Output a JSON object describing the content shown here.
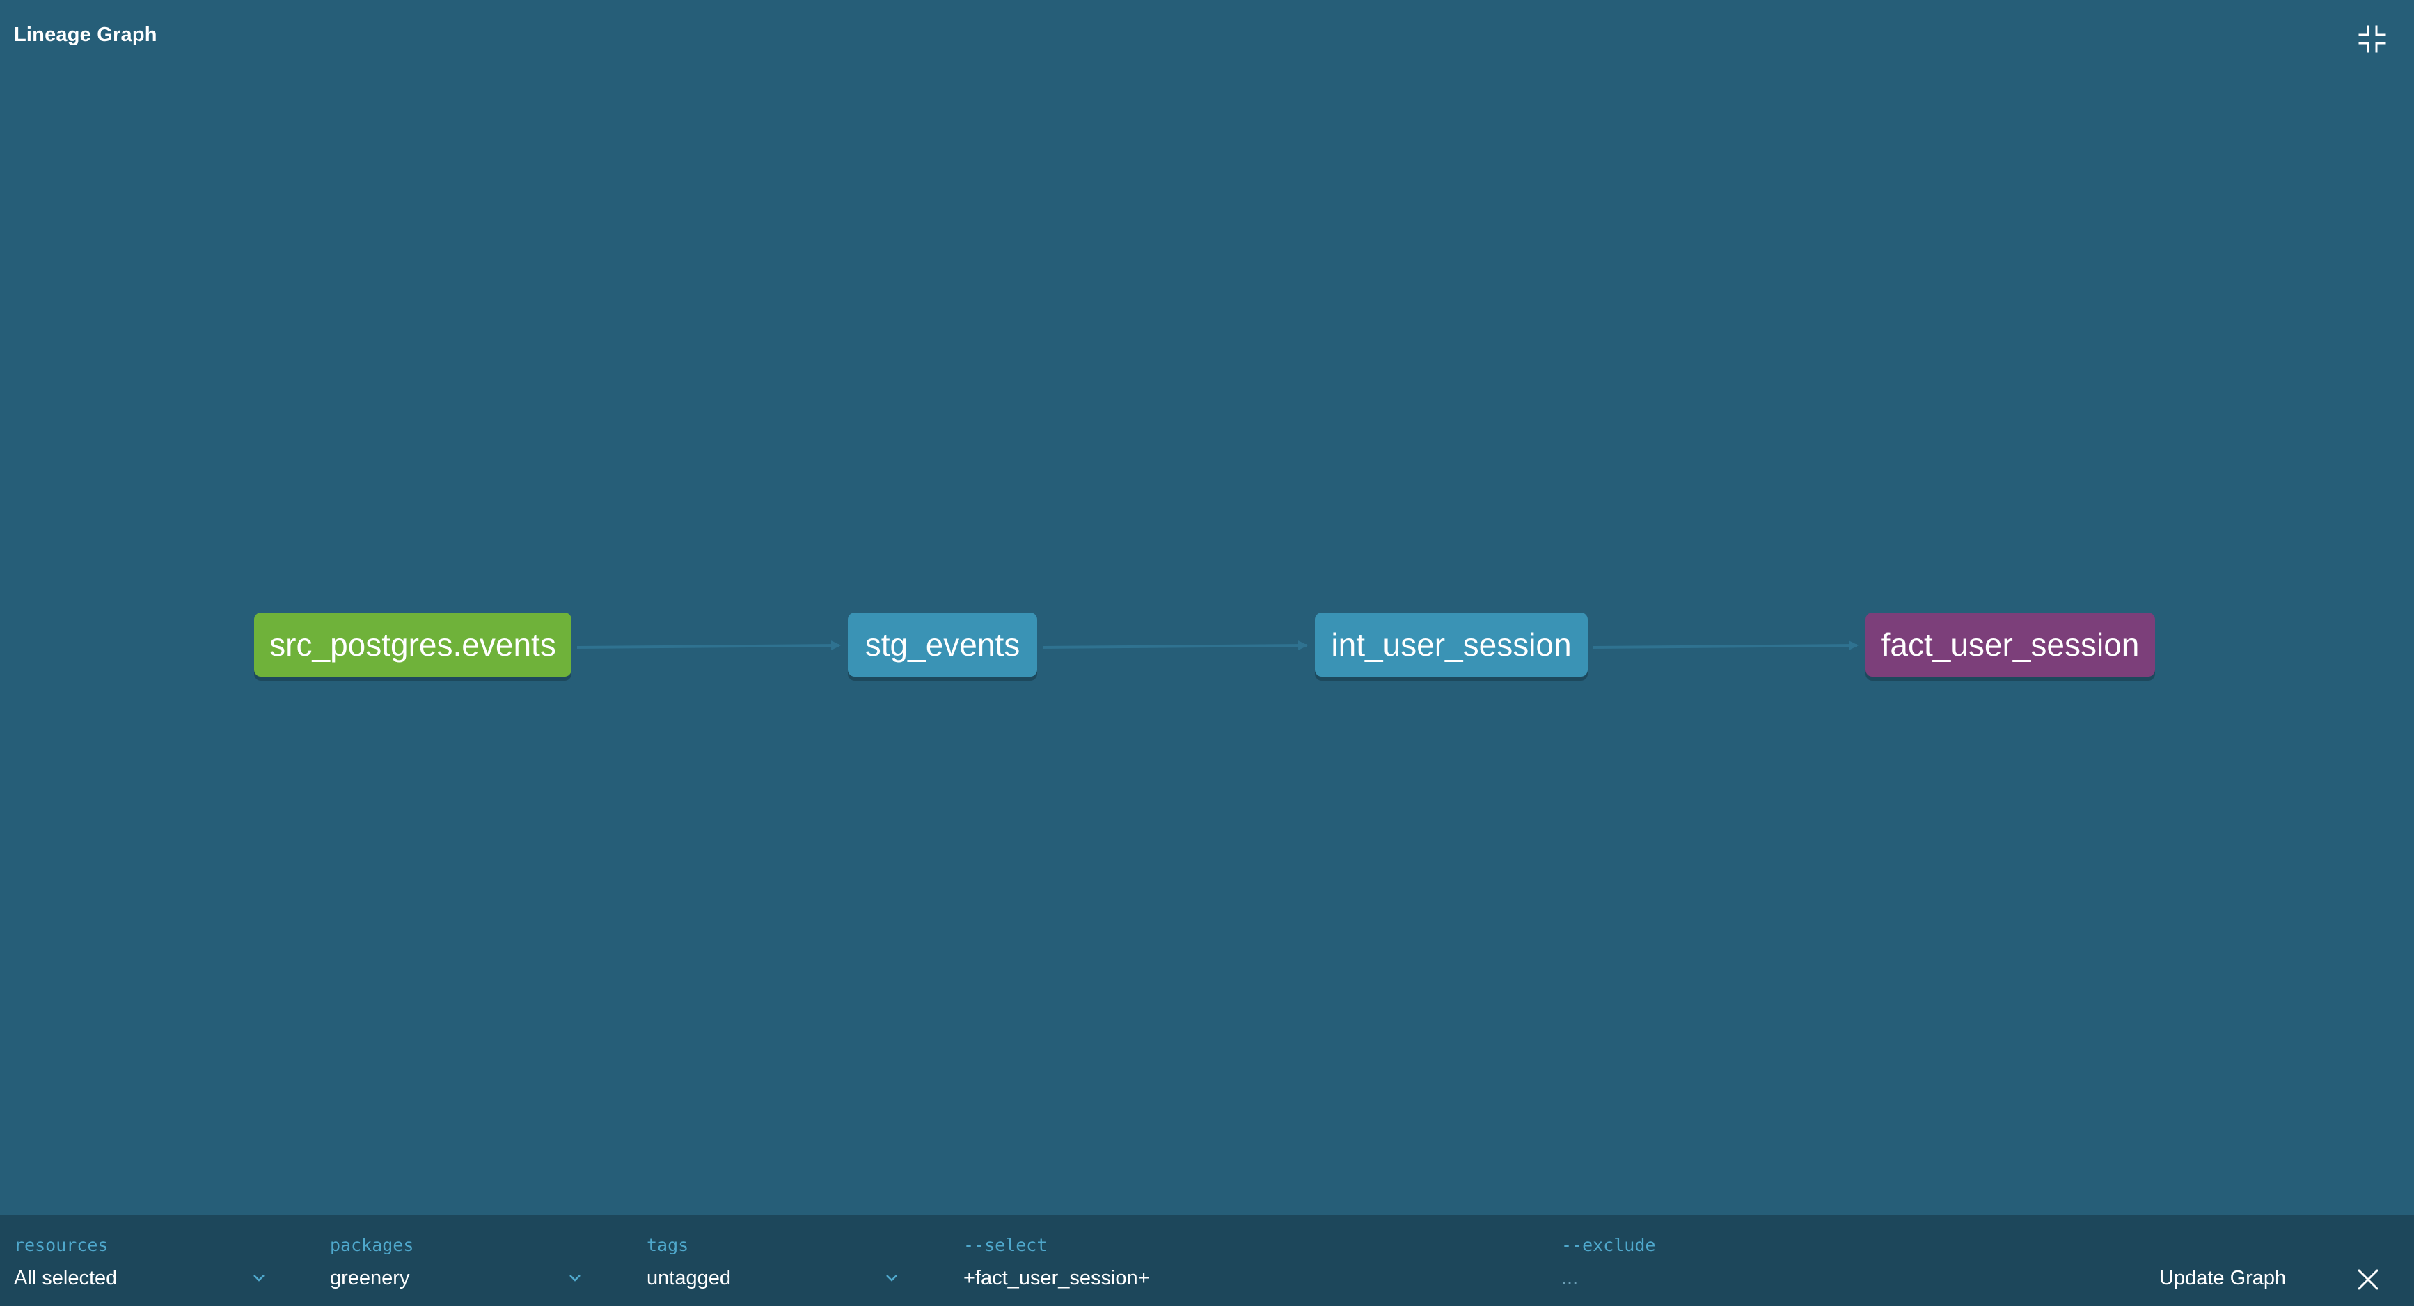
{
  "header": {
    "title": "Lineage Graph",
    "collapse_icon": "collapse-fullscreen-icon"
  },
  "graph": {
    "nodes": [
      {
        "id": "src",
        "label": "src_postgres.events",
        "color": "#6fb23a"
      },
      {
        "id": "stg",
        "label": "stg_events",
        "color": "#3a93b5"
      },
      {
        "id": "int",
        "label": "int_user_session",
        "color": "#3a93b5"
      },
      {
        "id": "fact",
        "label": "fact_user_session",
        "color": "#7c3f7a"
      }
    ],
    "edges": [
      {
        "from": "src",
        "to": "stg"
      },
      {
        "from": "stg",
        "to": "int"
      },
      {
        "from": "int",
        "to": "fact"
      }
    ]
  },
  "filters": {
    "resources": {
      "label": "resources",
      "value": "All selected"
    },
    "packages": {
      "label": "packages",
      "value": "greenery"
    },
    "tags": {
      "label": "tags",
      "value": "untagged"
    },
    "select": {
      "label": "--select",
      "value": "+fact_user_session+"
    },
    "exclude": {
      "label": "--exclude",
      "placeholder": "..."
    }
  },
  "actions": {
    "update_label": "Update Graph",
    "close_icon": "close-icon"
  },
  "colors": {
    "background": "#265e78",
    "footer": "#1d475b",
    "label_accent": "#4fa8cc",
    "edge": "#2f7290"
  }
}
